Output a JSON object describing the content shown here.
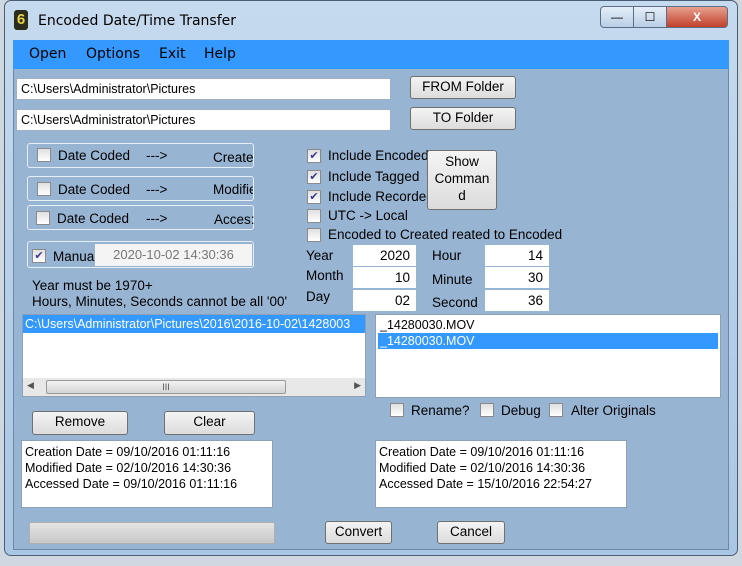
{
  "window": {
    "title": "Encoded Date/Time Transfer",
    "app_icon": "6",
    "minimize": "—",
    "maximize": "☐",
    "close": "X"
  },
  "menu": [
    "Open",
    "Options",
    "Exit",
    "Help"
  ],
  "paths": {
    "from_value": "C:\\Users\\Administrator\\Pictures",
    "to_value": "C:\\Users\\Administrator\\Pictures",
    "from_button": "FROM Folder",
    "to_button": "TO Folder"
  },
  "mappings": [
    {
      "label": "Date Coded",
      "arrow": "--->",
      "target": "Create",
      "checked": false
    },
    {
      "label": "Date Coded",
      "arrow": "--->",
      "target": "Modifie",
      "checked": false
    },
    {
      "label": "Date Coded",
      "arrow": "--->",
      "target": "Acces:",
      "checked": false
    }
  ],
  "manual": {
    "label": "Manua",
    "checked": true,
    "value": "2020-10-02 14:30:36"
  },
  "notes": [
    "Year must be 1970+",
    "Hours, Minutes, Seconds cannot be all '00'"
  ],
  "options": [
    {
      "label": "Include Encoded",
      "checked": true
    },
    {
      "label": "Include Tagged",
      "checked": true
    },
    {
      "label": "Include Recorded",
      "checked": true
    },
    {
      "label": "UTC -> Local",
      "checked": false
    },
    {
      "label": "Encoded to Created  reated to Encoded",
      "checked": false
    }
  ],
  "show_command": [
    "Show",
    "Comman",
    "d"
  ],
  "datetime": {
    "year_label": "Year",
    "year": "2020",
    "month_label": "Month",
    "month": "10",
    "day_label": "Day",
    "day": "02",
    "hour_label": "Hour",
    "hour": "14",
    "minute_label": "Minute",
    "minute": "30",
    "second_label": "Second",
    "second": "36"
  },
  "folders": [
    "C:\\Users\\Administrator\\Pictures\\2016\\2016-10-02\\1428003"
  ],
  "files": [
    "_14280030.MOV",
    "_14280030.MOV"
  ],
  "flags": [
    {
      "label": "Rename?",
      "checked": false
    },
    {
      "label": "Debug",
      "checked": false
    },
    {
      "label": "Alter Originals",
      "checked": false
    }
  ],
  "buttons": {
    "remove": "Remove",
    "clear": "Clear",
    "convert": "Convert",
    "cancel": "Cancel",
    "scroll_thumb": "III",
    "scroll_left": "◀",
    "scroll_right": "▶"
  },
  "info_left": [
    "Creation Date = 09/10/2016 01:11:16",
    "Modified Date = 02/10/2016 14:30:36",
    "Accessed Date = 09/10/2016 01:11:16"
  ],
  "info_right": [
    "Creation Date = 09/10/2016 01:11:16",
    "Modified Date = 02/10/2016 14:30:36",
    "Accessed Date = 15/10/2016 22:54:27"
  ],
  "progress": 0
}
